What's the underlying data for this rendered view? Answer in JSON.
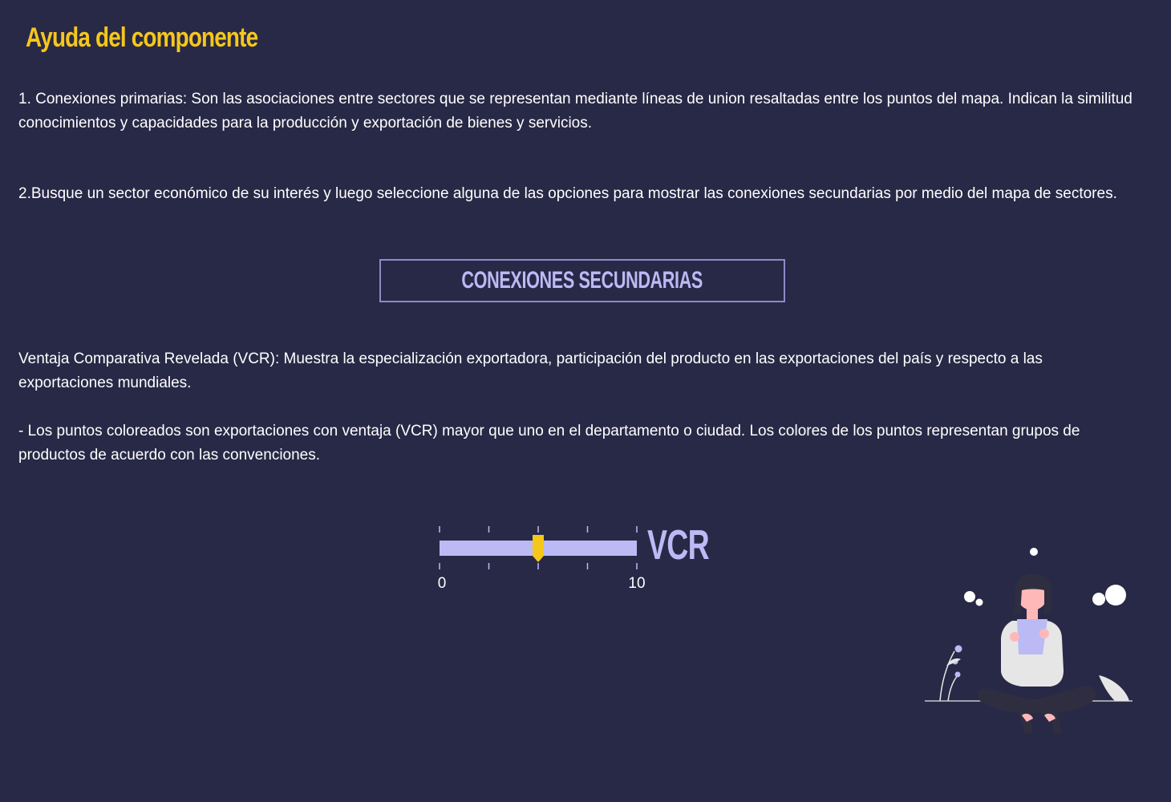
{
  "header": {
    "title": "Ayuda del componente"
  },
  "help": {
    "paragraph_1": "1. Conexiones primarias: Son las asociaciones entre sectores que se representan mediante líneas de union resaltadas entre los puntos del mapa. Indican la similitud conocimientos y capacidades para la producción y exportación de bienes y servicios.",
    "paragraph_2": "2.Busque un sector económico de su interés y luego seleccione alguna de las opciones para mostrar las conexiones secundarias por medio del mapa de sectores.",
    "button_label": "CONEXIONES SECUNDARIAS",
    "paragraph_3": "Ventaja Comparativa Revelada (VCR): Muestra la especialización exportadora, participación del producto en las exportaciones del país y respecto a las exportaciones mundiales.",
    "paragraph_4": "- Los puntos coloreados son exportaciones con ventaja (VCR) mayor que uno en el departamento o ciudad. Los colores de los puntos representan grupos de productos de acuerdo con las convenciones."
  },
  "vcr_slider": {
    "label": "VCR",
    "min_label": "0",
    "max_label": "10",
    "min": 0,
    "max": 10,
    "value": 5,
    "tick_count": 5
  },
  "colors": {
    "background": "#282946",
    "accent_yellow": "#f6c71b",
    "lavender": "#bbbaf5",
    "button_border": "#8b8bc8"
  },
  "illustration": {
    "icon": "person-reading-illustration"
  }
}
